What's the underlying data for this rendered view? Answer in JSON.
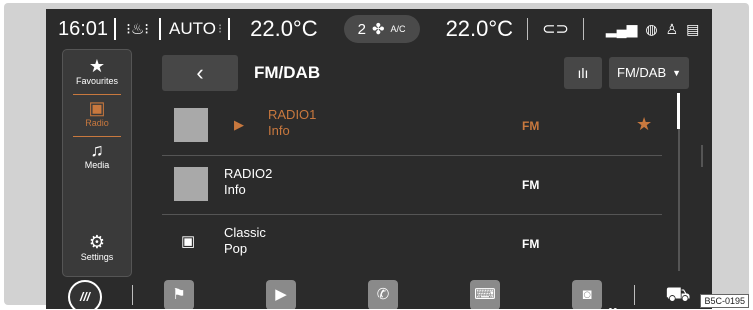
{
  "status_bar": {
    "time": "16:01",
    "auto_label": "AUTO",
    "temp_left": "22.0°C",
    "fan_speed": "2",
    "ac_label": "A/C",
    "temp_right": "22.0°C",
    "icons": [
      "seat-heat-icon",
      "fan-icon",
      "car-icon",
      "signal-icon",
      "globe-icon",
      "user-icon",
      "note-icon"
    ]
  },
  "sidebar": {
    "items": [
      {
        "label": "Favourites",
        "icon": "star-icon"
      },
      {
        "label": "Radio",
        "icon": "radio-icon",
        "active": true
      },
      {
        "label": "Media",
        "icon": "music-note-icon"
      },
      {
        "label": "Settings",
        "icon": "gear-icon"
      }
    ]
  },
  "header": {
    "back_label": "‹",
    "title": "FM/DAB",
    "band_select": "FM/DAB"
  },
  "stations": [
    {
      "name": "RADIO1",
      "info": "Info",
      "band": "FM",
      "playing": true,
      "favourite": true
    },
    {
      "name": "RADIO2",
      "info": "Info",
      "band": "FM",
      "playing": false,
      "favourite": false
    },
    {
      "name": "Classic",
      "info": "Pop",
      "band": "FM",
      "playing": false,
      "favourite": false
    }
  ],
  "bottom_bar": {
    "home_label": "///",
    "apps": [
      "flag-icon",
      "play-icon",
      "phone-icon",
      "keyboard-icon",
      "phone-app-icon"
    ]
  },
  "figure_code": "B5C-0195",
  "colors": {
    "accent": "#c8783e",
    "background": "#2b2b2b"
  }
}
